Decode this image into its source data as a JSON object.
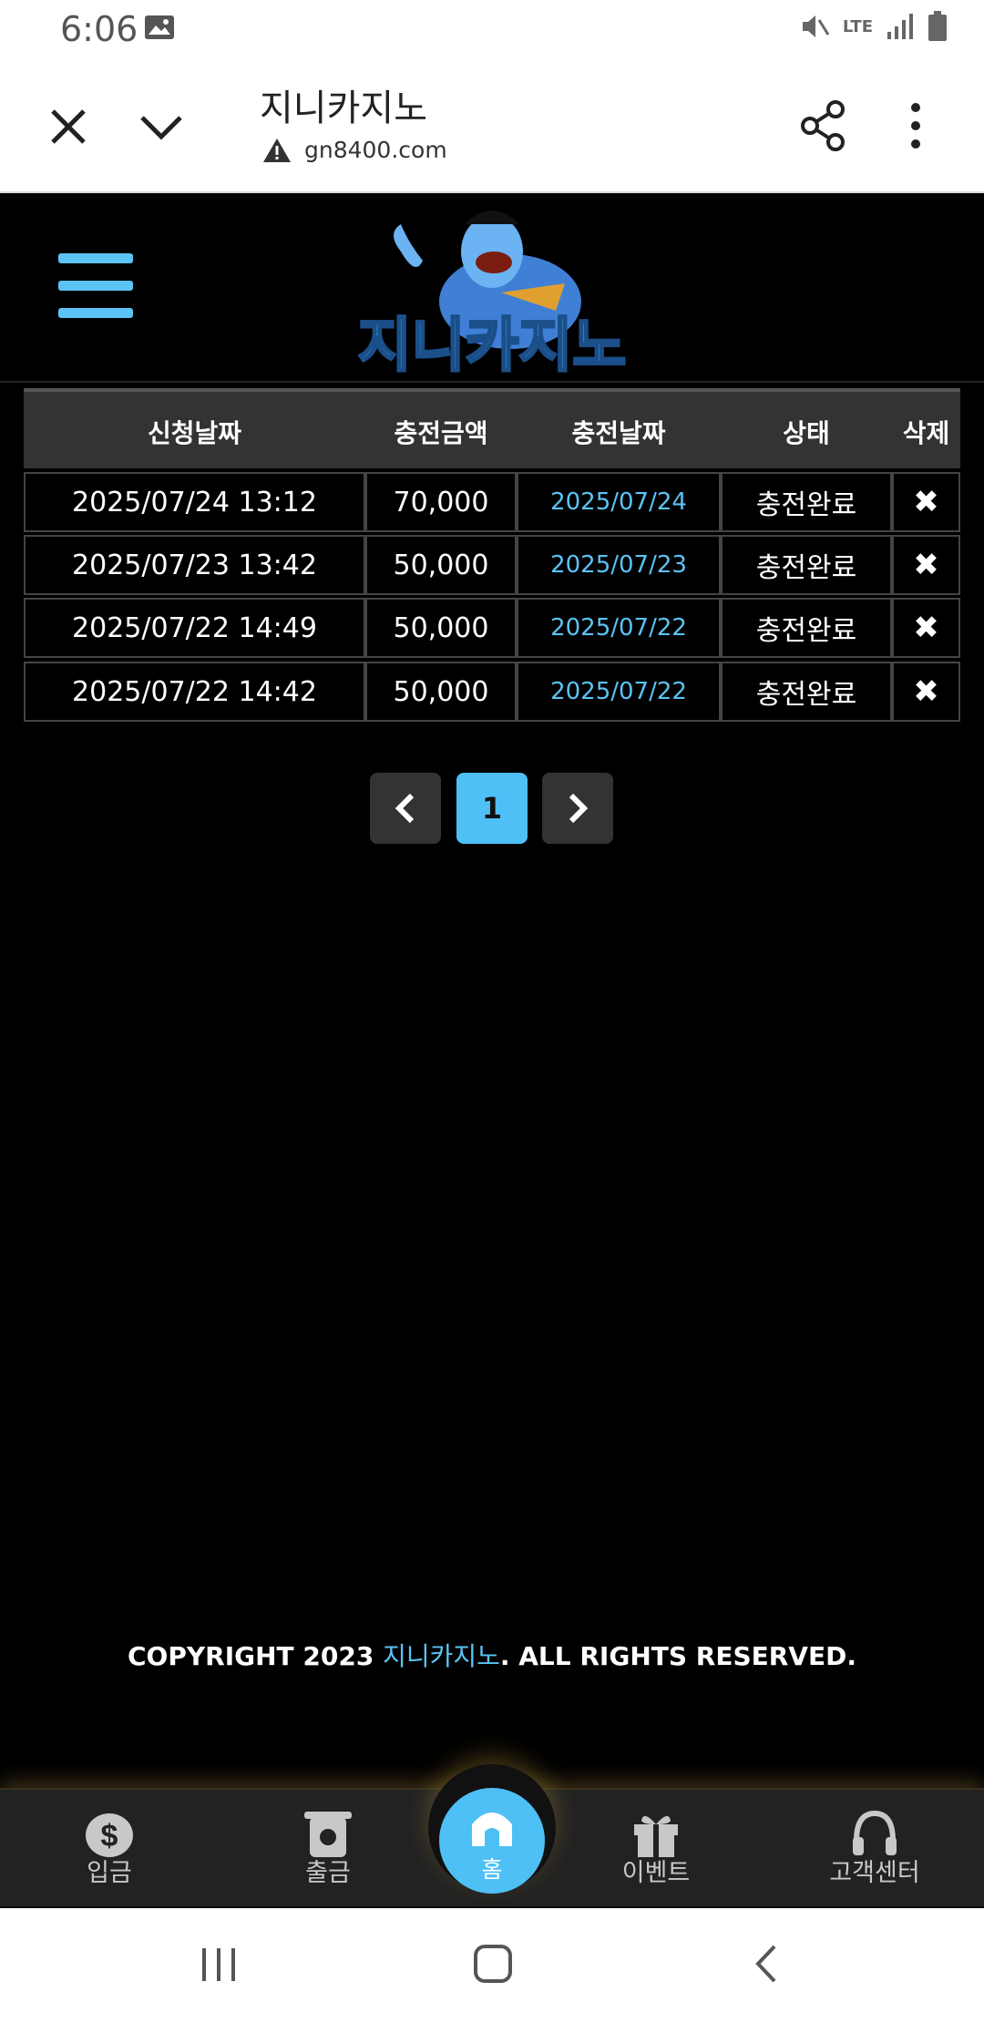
{
  "status_bar": {
    "time": "6:06",
    "network": "LTE"
  },
  "browser": {
    "page_title": "지니카지노",
    "url": "gn8400.com",
    "icons": [
      "close-icon",
      "chevron-down-icon",
      "warning-icon",
      "share-icon",
      "more-vert-icon"
    ]
  },
  "site": {
    "logo_text": "지니카지노"
  },
  "table": {
    "headers": [
      "신청날짜",
      "충전금액",
      "충전날짜",
      "상태",
      "삭제"
    ],
    "rows": [
      {
        "request_date": "2025/07/24 13:12",
        "amount": "70,000",
        "charge_date": "2025/07/24",
        "status": "충전완료"
      },
      {
        "request_date": "2025/07/23 13:42",
        "amount": "50,000",
        "charge_date": "2025/07/23",
        "status": "충전완료"
      },
      {
        "request_date": "2025/07/22 14:49",
        "amount": "50,000",
        "charge_date": "2025/07/22",
        "status": "충전완료"
      },
      {
        "request_date": "2025/07/22 14:42",
        "amount": "50,000",
        "charge_date": "2025/07/22",
        "status": "충전완료"
      }
    ],
    "delete_symbol": "✖"
  },
  "pagination": {
    "current": "1"
  },
  "footer": {
    "copyright_prefix": "COPYRIGHT 2023 ",
    "brand": "지니카지노",
    "copyright_suffix": ". ALL RIGHTS RESERVED."
  },
  "bottom_nav": {
    "items": [
      {
        "label": "입금"
      },
      {
        "label": "출금"
      },
      {
        "label": "홈"
      },
      {
        "label": "이벤트"
      },
      {
        "label": "고객센터"
      }
    ]
  },
  "colors": {
    "accent": "#4ec0f5",
    "background": "#000000",
    "header_row": "#333333"
  }
}
